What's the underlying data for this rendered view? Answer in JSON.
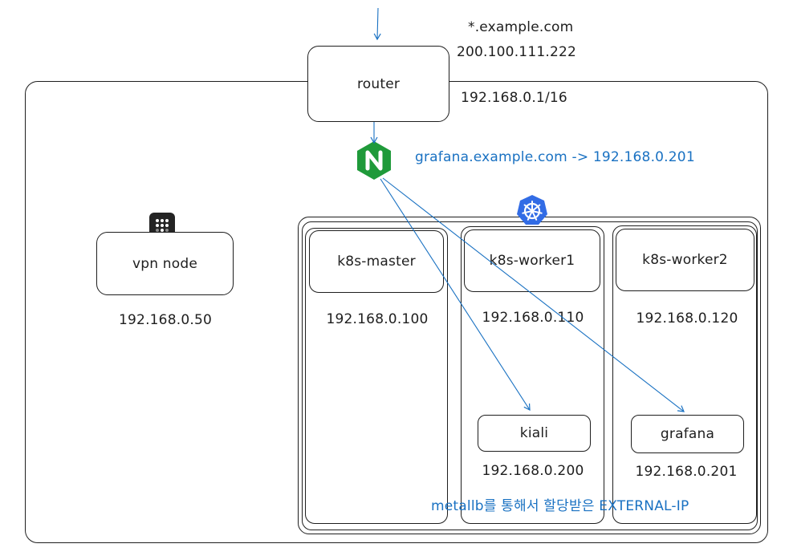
{
  "router": {
    "label": "router",
    "domain": "*.example.com",
    "public_ip": "200.100.111.222",
    "private_cidr": "192.168.0.1/16"
  },
  "ingress": {
    "icon": "nginx-icon",
    "route_text": "grafana.example.com -> 192.168.0.201"
  },
  "cluster": {
    "icon": "kubernetes-icon"
  },
  "vpn": {
    "icon": "tailscale-icon",
    "label": "vpn node",
    "ip": "192.168.0.50"
  },
  "nodes": [
    {
      "label": "k8s-master",
      "ip": "192.168.0.100"
    },
    {
      "label": "k8s-worker1",
      "ip": "192.168.0.110"
    },
    {
      "label": "k8s-worker2",
      "ip": "192.168.0.120"
    }
  ],
  "services": [
    {
      "label": "kiali",
      "ip": "192.168.0.200"
    },
    {
      "label": "grafana",
      "ip": "192.168.0.201"
    }
  ],
  "note": "metallb를 통해서 할당받은 EXTERNAL-IP",
  "colors": {
    "stroke": "#1e1e1e",
    "accent_blue": "#1971c2",
    "nginx_green": "#1f9a3a",
    "k8s_blue": "#326ce5"
  }
}
